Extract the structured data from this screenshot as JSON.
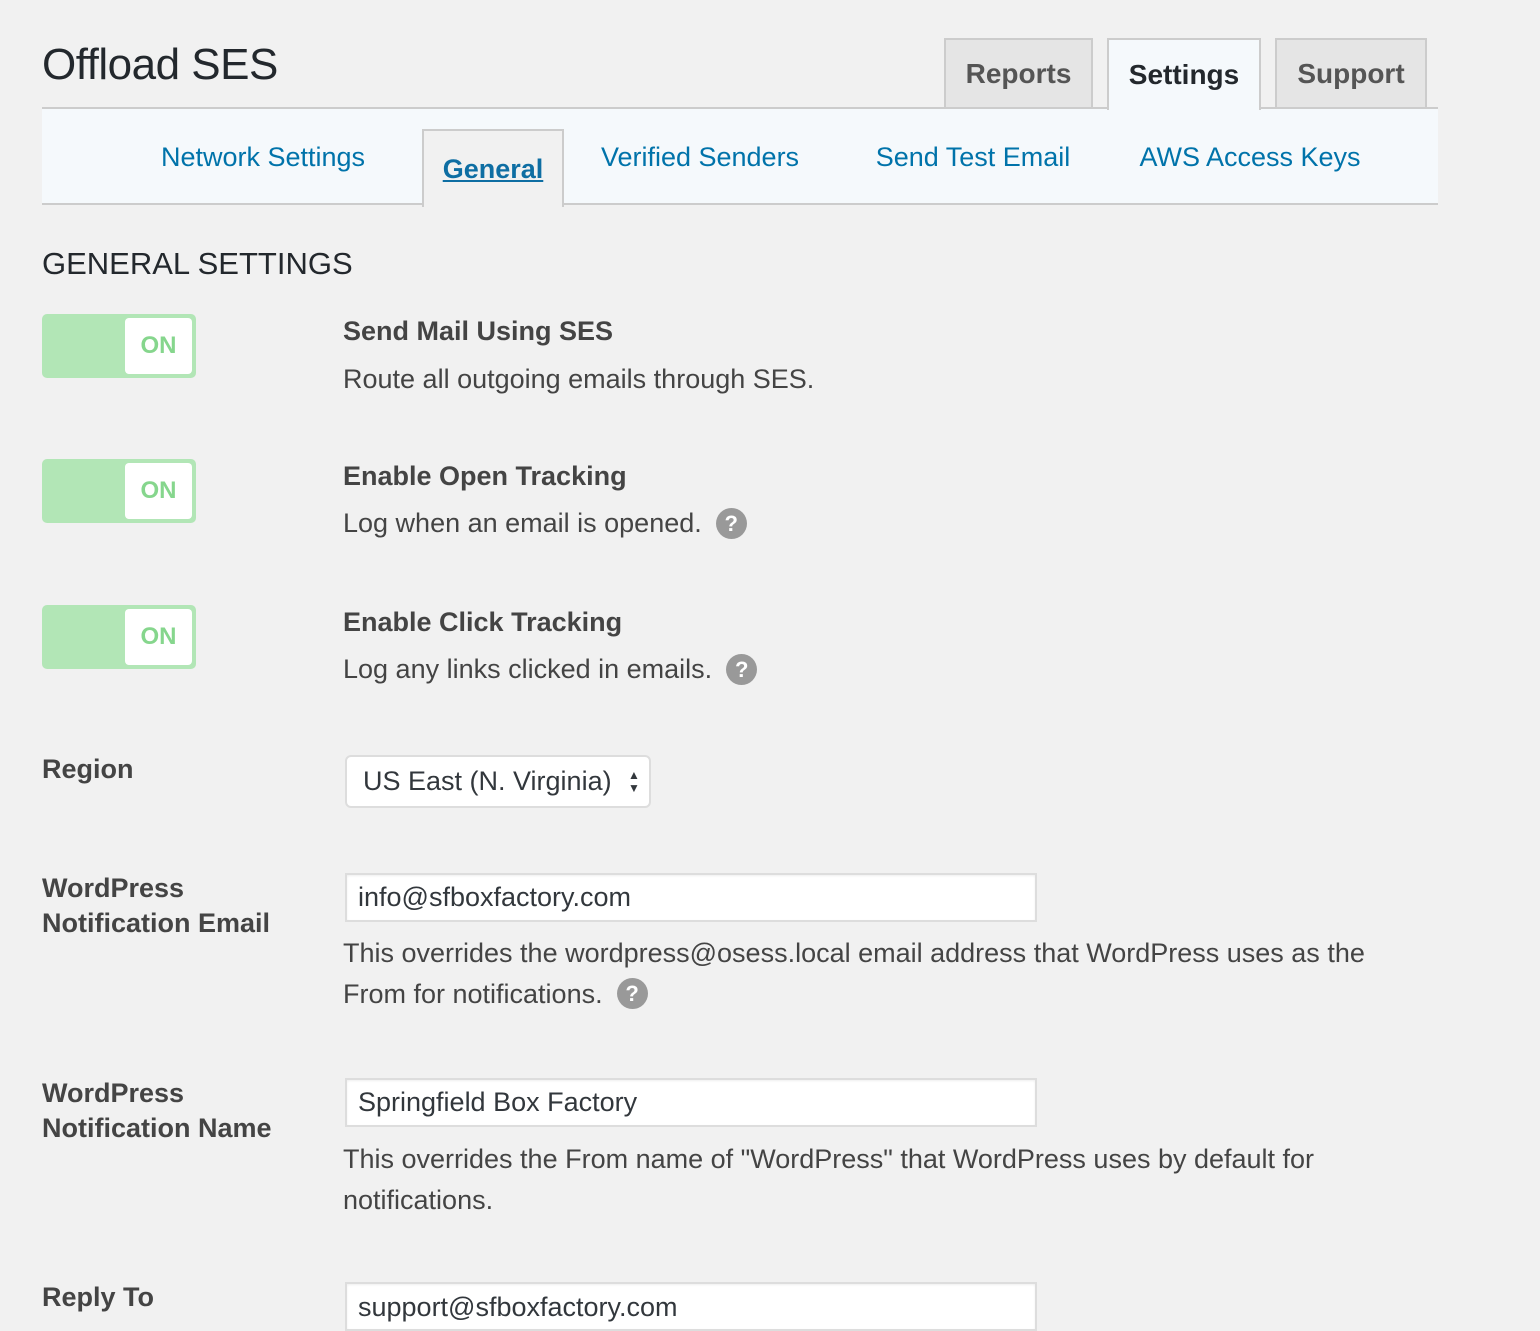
{
  "page": {
    "title": "Offload SES"
  },
  "top_tabs": [
    {
      "label": "Reports",
      "active": false
    },
    {
      "label": "Settings",
      "active": true
    },
    {
      "label": "Support",
      "active": false
    }
  ],
  "sub_nav": [
    {
      "label": "Network Settings",
      "active": false
    },
    {
      "label": "General",
      "active": true
    },
    {
      "label": "Verified Senders",
      "active": false
    },
    {
      "label": "Send Test Email",
      "active": false
    },
    {
      "label": "AWS Access Keys",
      "active": false
    }
  ],
  "section": {
    "title": "GENERAL SETTINGS"
  },
  "options": [
    {
      "toggle_label": "ON",
      "enabled": true,
      "title": "Send Mail Using SES",
      "description": "Route all outgoing emails through SES.",
      "help": false
    },
    {
      "toggle_label": "ON",
      "enabled": true,
      "title": "Enable Open Tracking",
      "description": "Log when an email is opened.",
      "help": true
    },
    {
      "toggle_label": "ON",
      "enabled": true,
      "title": "Enable Click Tracking",
      "description": "Log any links clicked in emails.",
      "help": true
    }
  ],
  "help_icon_glyph": "?",
  "region": {
    "label": "Region",
    "selected": "US East (N. Virginia)",
    "arrow_up": "▲",
    "arrow_down": "▼"
  },
  "notification_email": {
    "label_line1": "WordPress",
    "label_line2": "Notification Email",
    "value": "info@sfboxfactory.com",
    "description_line1": "This overrides the wordpress@osess.local email address that WordPress uses as the",
    "description_line2": "From for notifications."
  },
  "notification_name": {
    "label_line1": "WordPress",
    "label_line2": "Notification Name",
    "value": "Springfield Box Factory",
    "description_line1": "This overrides the From name of \"WordPress\" that WordPress uses by default for",
    "description_line2": "notifications."
  },
  "reply_to": {
    "label": "Reply To",
    "value": "support@sfboxfactory.com"
  },
  "colors": {
    "link": "#0073aa",
    "toggle_on_bg": "#b2e6b6",
    "toggle_on_text": "#86d68d",
    "help_icon": "#999999"
  }
}
